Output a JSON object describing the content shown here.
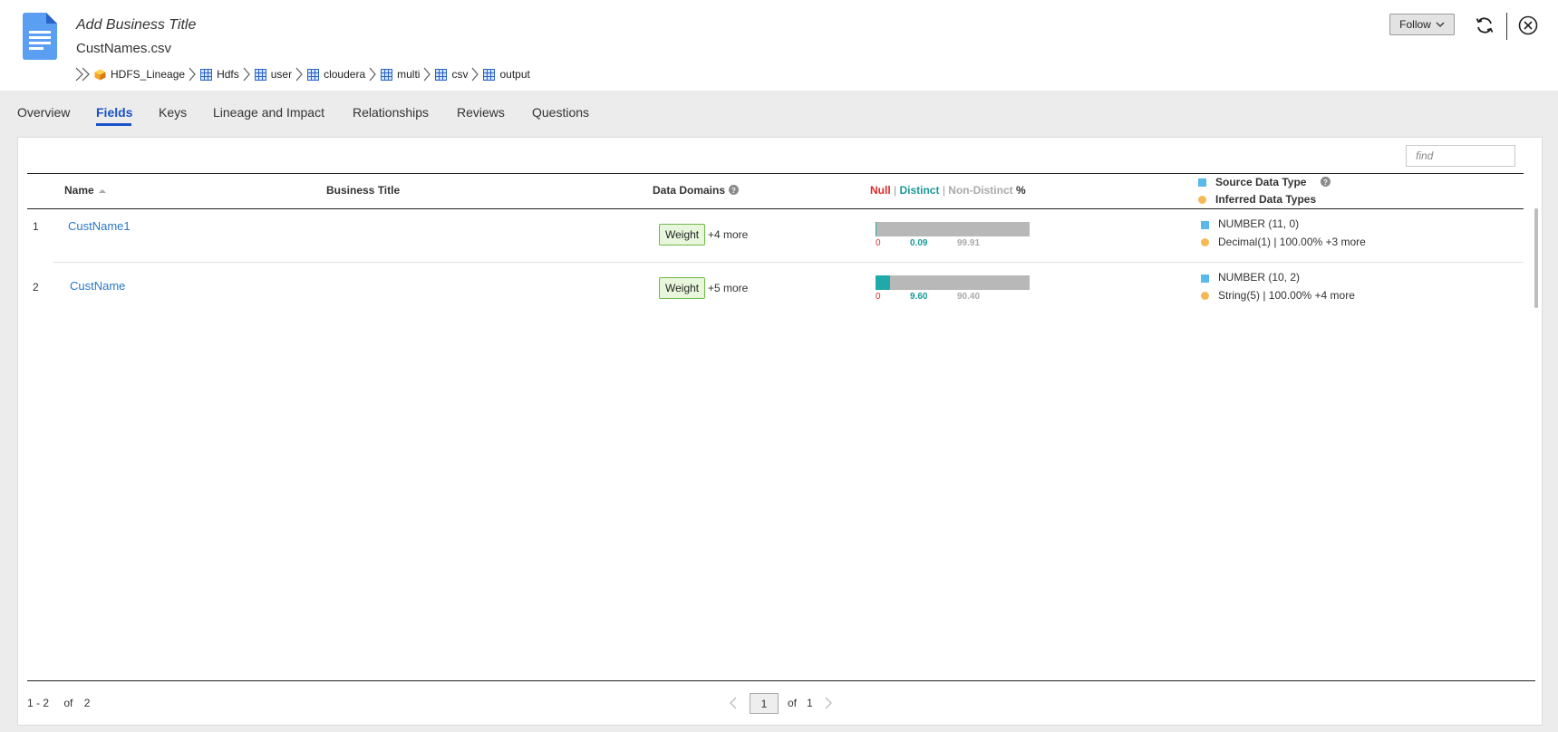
{
  "header": {
    "business_title": "Add Business Title",
    "file_name": "CustNames.csv",
    "breadcrumb": [
      "HDFS_Lineage",
      "Hdfs",
      "user",
      "cloudera",
      "multi",
      "csv",
      "output"
    ],
    "follow_label": "Follow"
  },
  "tabs": [
    "Overview",
    "Fields",
    "Keys",
    "Lineage and Impact",
    "Relationships",
    "Reviews",
    "Questions"
  ],
  "active_tab": "Fields",
  "search": {
    "placeholder": "find"
  },
  "table": {
    "columns": {
      "name": "Name",
      "business_title": "Business Title",
      "data_domains": "Data Domains",
      "null_label": "Null",
      "sep1": " | ",
      "distinct_label": "Distinct",
      "sep2": " | ",
      "nondistinct_label": "Non-Distinct",
      "percent_label": " %",
      "source_type": "Source Data Type",
      "inferred_types": "Inferred Data Types"
    },
    "rows": [
      {
        "num": "1",
        "name": "CustName1",
        "domain_tag": "Weight",
        "domain_more": "+4 more",
        "null_pct": "0",
        "distinct_pct": "0.09",
        "nondistinct_pct": "99.91",
        "distinct_fraction": 0.0009,
        "source_type": "NUMBER (11, 0)",
        "inferred_type": "Decimal(1) | 100.00% +3 more"
      },
      {
        "num": "2",
        "name": "CustName",
        "domain_tag": "Weight",
        "domain_more": "+5 more",
        "null_pct": "0",
        "distinct_pct": "9.60",
        "nondistinct_pct": "90.40",
        "distinct_fraction": 0.096,
        "source_type": "NUMBER (10, 2)",
        "inferred_type": "String(5) | 100.00% +4 more"
      }
    ]
  },
  "pager": {
    "range": "1 - 2",
    "of_label": "of",
    "total": "2",
    "current_page": "1",
    "page_of": "of",
    "total_pages": "1"
  },
  "colors": {
    "accent": "#1a52c8",
    "link": "#2a78c8",
    "null": "#e02a2a",
    "distinct": "#1fa9a8",
    "nondistinct": "#b8b8b8",
    "source_type": "#5bb8ea",
    "inferred_type": "#f6b956"
  },
  "icons": {
    "document": "document-icon",
    "breadcrumb_start": "double-chevron-icon",
    "datasource": "cube-icon",
    "folder": "grid-icon",
    "refresh": "refresh-icon",
    "close": "close-circle-icon",
    "help": "help-icon"
  }
}
